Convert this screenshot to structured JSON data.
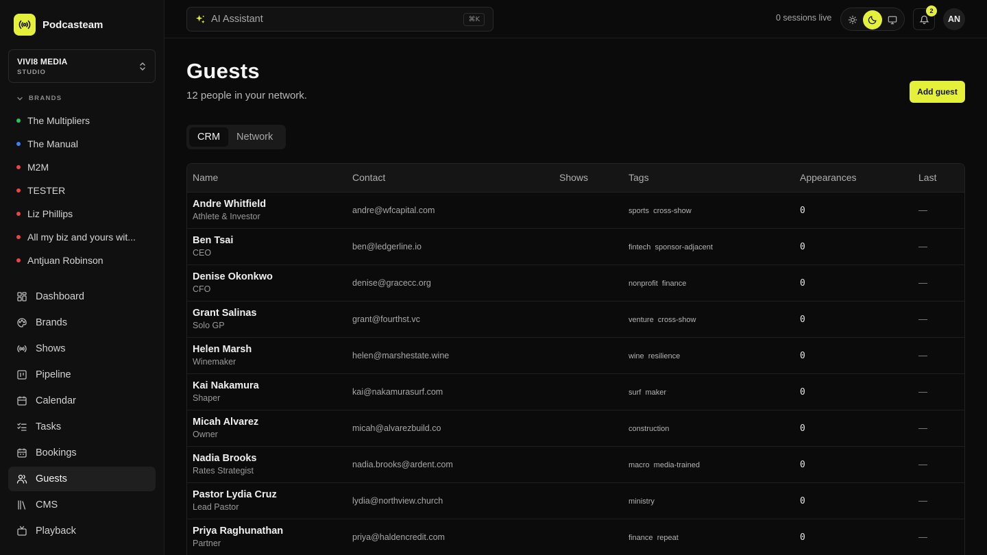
{
  "app": {
    "name": "Podcasteam"
  },
  "org": {
    "name": "VIVI8 MEDIA",
    "sub": "STUDIO"
  },
  "brands": {
    "heading": "BRANDS",
    "items": [
      {
        "label": "The Multipliers",
        "color": "#22c55e"
      },
      {
        "label": "The Manual",
        "color": "#3b82f6"
      },
      {
        "label": "M2M",
        "color": "#ef4444"
      },
      {
        "label": "TESTER",
        "color": "#ef4444"
      },
      {
        "label": "Liz Phillips",
        "color": "#ef4444"
      },
      {
        "label": "All my biz and yours wit...",
        "color": "#ef4444"
      },
      {
        "label": "Antjuan Robinson",
        "color": "#ef4444"
      }
    ]
  },
  "nav": {
    "items": [
      {
        "label": "Dashboard",
        "icon": "dashboard-icon"
      },
      {
        "label": "Brands",
        "icon": "palette-icon"
      },
      {
        "label": "Shows",
        "icon": "broadcast-icon"
      },
      {
        "label": "Pipeline",
        "icon": "pipeline-icon"
      },
      {
        "label": "Calendar",
        "icon": "calendar-icon"
      },
      {
        "label": "Tasks",
        "icon": "tasks-icon"
      },
      {
        "label": "Bookings",
        "icon": "bookings-icon"
      },
      {
        "label": "Guests",
        "icon": "users-icon",
        "active": true
      },
      {
        "label": "CMS",
        "icon": "library-icon"
      },
      {
        "label": "Playback",
        "icon": "tv-icon"
      }
    ]
  },
  "topbar": {
    "assistant_label": "AI Assistant",
    "shortcut": "⌘K",
    "sessions": "0 sessions live",
    "notification_count": "2",
    "avatar_initials": "AN"
  },
  "page": {
    "title": "Guests",
    "subtitle": "12 people in your network.",
    "add_button": "Add guest"
  },
  "tabs": [
    {
      "label": "CRM",
      "active": true
    },
    {
      "label": "Network",
      "active": false
    }
  ],
  "table": {
    "columns": [
      "Name",
      "Contact",
      "Shows",
      "Tags",
      "Appearances",
      "Last"
    ],
    "rows": [
      {
        "name": "Andre Whitfield",
        "role": "Athlete & Investor",
        "contact": "andre@wfcapital.com",
        "shows": "",
        "tags": "sports  cross-show",
        "appearances": "0",
        "last": "—"
      },
      {
        "name": "Ben Tsai",
        "role": "CEO",
        "contact": "ben@ledgerline.io",
        "shows": "",
        "tags": "fintech  sponsor-adjacent",
        "appearances": "0",
        "last": "—"
      },
      {
        "name": "Denise Okonkwo",
        "role": "CFO",
        "contact": "denise@gracecc.org",
        "shows": "",
        "tags": "nonprofit  finance",
        "appearances": "0",
        "last": "—"
      },
      {
        "name": "Grant Salinas",
        "role": "Solo GP",
        "contact": "grant@fourthst.vc",
        "shows": "",
        "tags": "venture  cross-show",
        "appearances": "0",
        "last": "—"
      },
      {
        "name": "Helen Marsh",
        "role": "Winemaker",
        "contact": "helen@marshestate.wine",
        "shows": "",
        "tags": "wine  resilience",
        "appearances": "0",
        "last": "—"
      },
      {
        "name": "Kai Nakamura",
        "role": "Shaper",
        "contact": "kai@nakamurasurf.com",
        "shows": "",
        "tags": "surf  maker",
        "appearances": "0",
        "last": "—"
      },
      {
        "name": "Micah Alvarez",
        "role": "Owner",
        "contact": "micah@alvarezbuild.co",
        "shows": "",
        "tags": "construction",
        "appearances": "0",
        "last": "—"
      },
      {
        "name": "Nadia Brooks",
        "role": "Rates Strategist",
        "contact": "nadia.brooks@ardent.com",
        "shows": "",
        "tags": "macro  media-trained",
        "appearances": "0",
        "last": "—"
      },
      {
        "name": "Pastor Lydia Cruz",
        "role": "Lead Pastor",
        "contact": "lydia@northview.church",
        "shows": "",
        "tags": "ministry",
        "appearances": "0",
        "last": "—"
      },
      {
        "name": "Priya Raghunathan",
        "role": "Partner",
        "contact": "priya@haldencredit.com",
        "shows": "",
        "tags": "finance  repeat",
        "appearances": "0",
        "last": "—"
      }
    ]
  },
  "colors": {
    "accent": "#e4f03a",
    "background": "#0b0b0b",
    "sidebar": "#101010"
  }
}
